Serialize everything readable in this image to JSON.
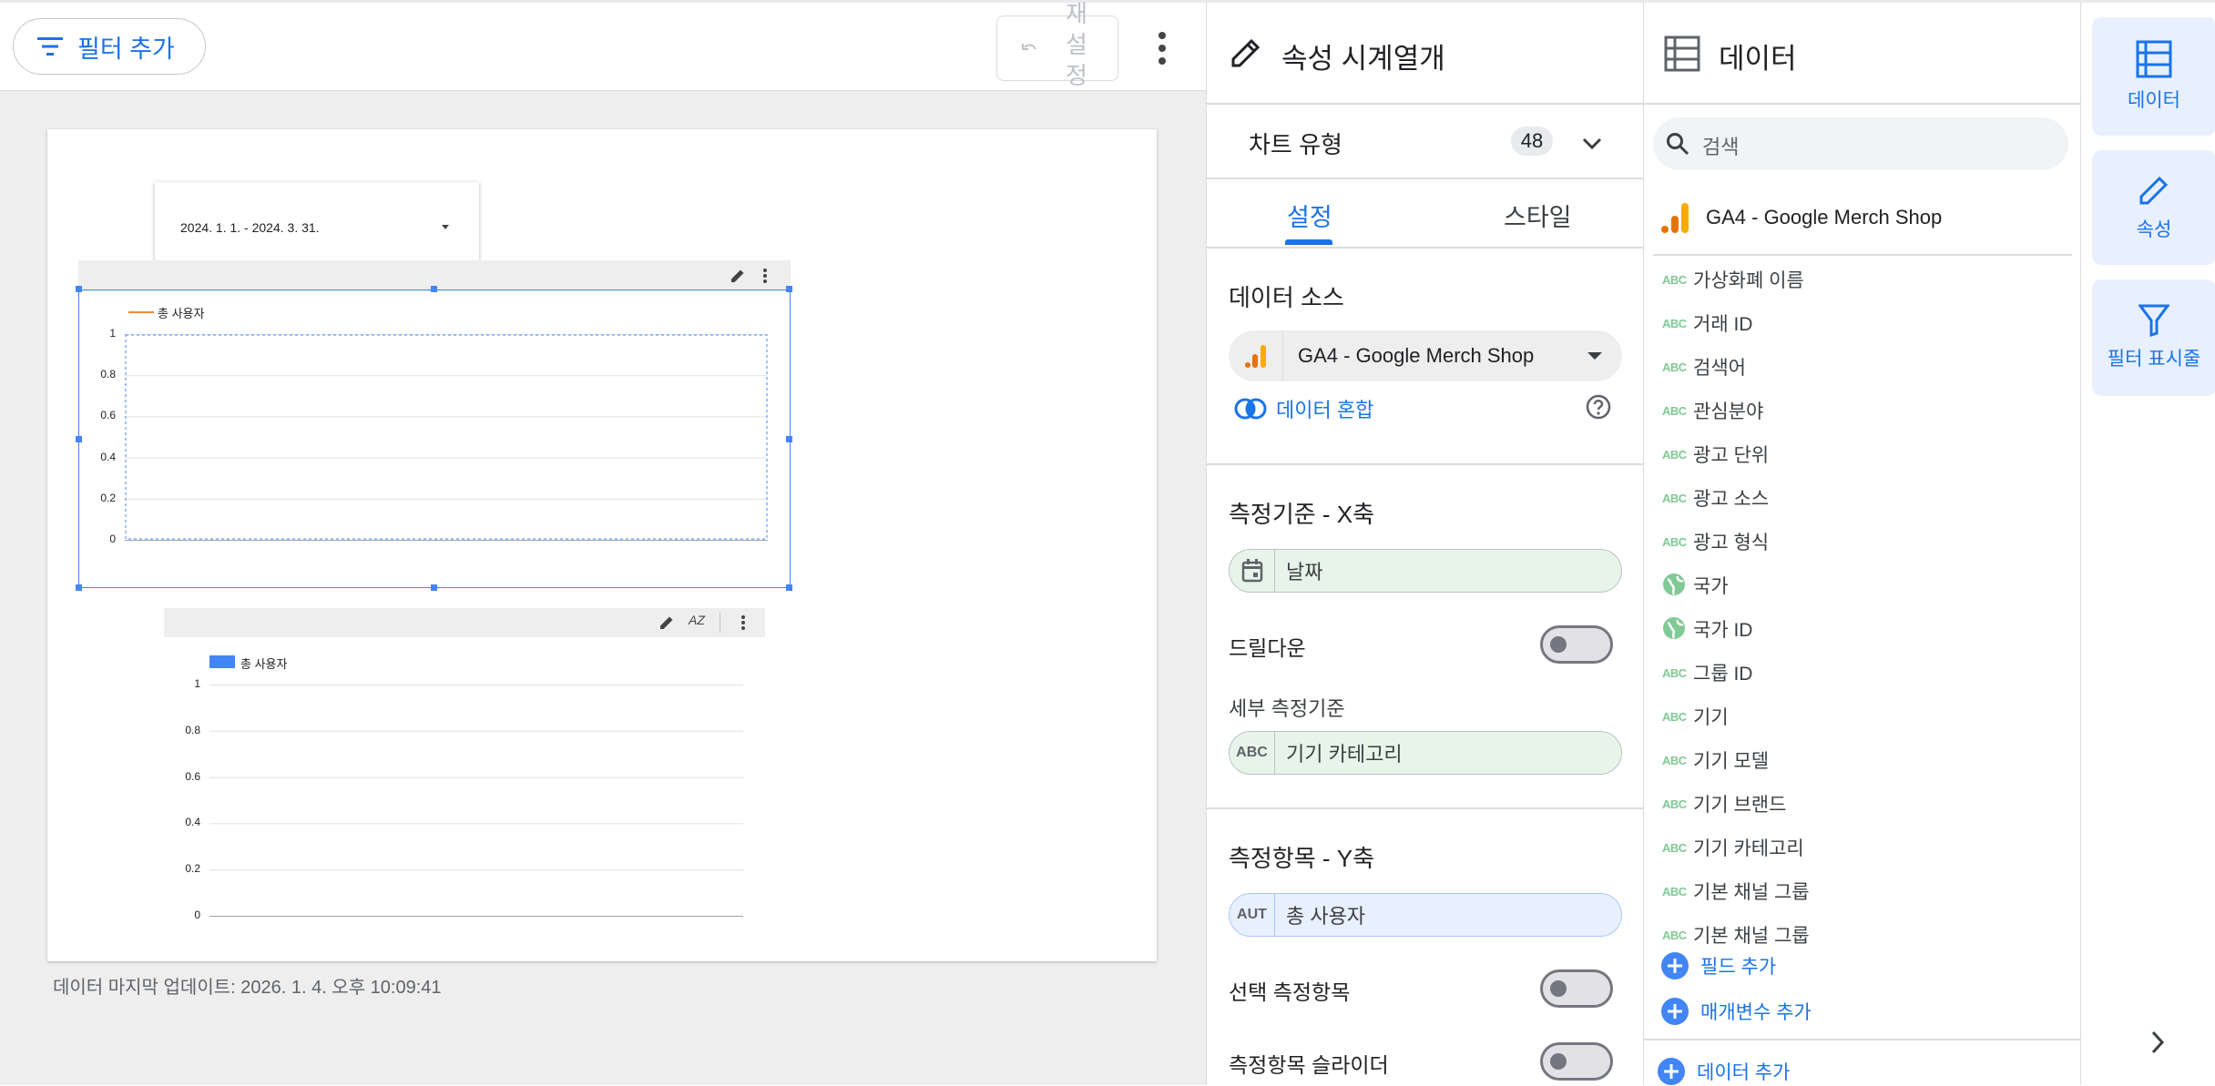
{
  "toolbar": {
    "add_filter_label": "필터 추가",
    "reset_label": "재설정"
  },
  "canvas": {
    "date_range": "2024. 1. 1. - 2024. 3. 31.",
    "last_updated": "데이터 마지막 업데이트: 2026. 1. 4. 오후 10:09:41"
  },
  "chart_data": [
    {
      "type": "line",
      "series": [
        {
          "name": "총 사용자",
          "values": []
        }
      ],
      "y_ticks": [
        "1",
        "0.8",
        "0.6",
        "0.4",
        "0.2",
        "0"
      ],
      "ylim": [
        0,
        1
      ],
      "grid": true,
      "legend": "top-left",
      "color": "#f28b3c"
    },
    {
      "type": "bar",
      "series": [
        {
          "name": "총 사용자",
          "values": []
        }
      ],
      "y_ticks": [
        "1",
        "0.8",
        "0.6",
        "0.4",
        "0.2",
        "0"
      ],
      "ylim": [
        0,
        1
      ],
      "grid": true,
      "legend": "top-left",
      "color": "#4285f4"
    }
  ],
  "props": {
    "title": "속성 시계열개",
    "chart_type_label": "차트 유형",
    "chart_type_badge": "48",
    "tab_setup": "설정",
    "tab_style": "스타일",
    "data_source_title": "데이터 소스",
    "data_source_value": "GA4 - Google Merch Shop",
    "blend_label": "데이터 혼합",
    "dimension_title": "측정기준 - X축",
    "dimension_value": "날짜",
    "drilldown_label": "드릴다운",
    "breakdown_title": "세부 측정기준",
    "breakdown_icon": "ABC",
    "breakdown_value": "기기 카테고리",
    "metric_title": "측정항목 - Y축",
    "metric_icon": "AUT",
    "metric_value": "총 사용자",
    "optional_metrics_label": "선택 측정항목",
    "metric_slider_label": "측정항목 슬라이더"
  },
  "data_panel": {
    "title": "데이터",
    "search_placeholder": "검색",
    "source_name": "GA4 - Google Merch Shop",
    "field_type_text": "ABC",
    "fields": [
      {
        "label": "가상화폐 이름",
        "kind": "text"
      },
      {
        "label": "거래 ID",
        "kind": "text"
      },
      {
        "label": "검색어",
        "kind": "text"
      },
      {
        "label": "관심분야",
        "kind": "text"
      },
      {
        "label": "광고 단위",
        "kind": "text"
      },
      {
        "label": "광고 소스",
        "kind": "text"
      },
      {
        "label": "광고 형식",
        "kind": "text"
      },
      {
        "label": "국가",
        "kind": "geo"
      },
      {
        "label": "국가 ID",
        "kind": "geo"
      },
      {
        "label": "그룹 ID",
        "kind": "text"
      },
      {
        "label": "기기",
        "kind": "text"
      },
      {
        "label": "기기 모델",
        "kind": "text"
      },
      {
        "label": "기기 브랜드",
        "kind": "text"
      },
      {
        "label": "기기 카테고리",
        "kind": "text"
      },
      {
        "label": "기본 채널 그룹",
        "kind": "text"
      },
      {
        "label": "기본 채널 그룹",
        "kind": "text"
      }
    ],
    "add_field_label": "필드 추가",
    "add_param_label": "매개변수 추가",
    "add_data_label": "데이터 추가"
  },
  "rail": {
    "data_label": "데이터",
    "props_label": "속성",
    "filter_label": "필터 표시줄"
  },
  "colors": {
    "accent": "#1a73e8",
    "dimension_chip": "#e6f4ea",
    "metric_chip": "#e8f0fe",
    "ga_orange": "#f29900"
  }
}
